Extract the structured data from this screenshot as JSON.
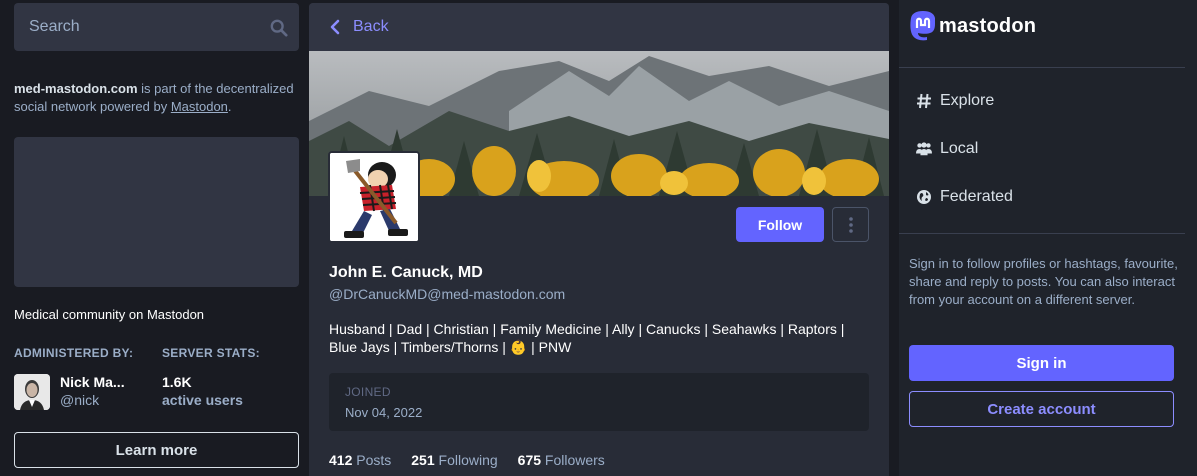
{
  "search": {
    "placeholder": "Search"
  },
  "sidebar_left": {
    "server_domain": "med-mastodon.com",
    "about_text": " is part of the decentralized social network powered by ",
    "mastodon_link": "Mastodon",
    "period": ".",
    "server_description": "Medical community on Mastodon",
    "administered_by_label": "ADMINISTERED BY:",
    "server_stats_label": "SERVER STATS:",
    "admin_name": "Nick Ma...",
    "admin_handle": "@nick",
    "stat_value": "1.6K",
    "stat_sub": "active users",
    "learn_more": "Learn more"
  },
  "profile": {
    "back_label": "Back",
    "follow_label": "Follow",
    "display_name": "John E. Canuck, MD",
    "account": "@DrCanuckMD@med-mastodon.com",
    "bio_text": "Husband | Dad | Christian | Family Medicine | Ally | Canucks | Seahawks | Raptors | Blue Jays | Timbers/Thorns | ",
    "bio_emoji": "👶",
    "bio_end": " | PNW",
    "joined_label": "JOINED",
    "joined_date": "Nov 04, 2022",
    "counts": [
      {
        "num": "412",
        "label": "Posts"
      },
      {
        "num": "251",
        "label": "Following"
      },
      {
        "num": "675",
        "label": "Followers"
      }
    ]
  },
  "sidebar_right": {
    "logo_text": "mastodon",
    "nav": [
      {
        "label": "Explore",
        "icon": "hashtag-icon"
      },
      {
        "label": "Local",
        "icon": "users-icon"
      },
      {
        "label": "Federated",
        "icon": "globe-icon"
      }
    ],
    "signin_text": "Sign in to follow profiles or hashtags, favourite, share and reply to posts. You can also interact from your account on a different server.",
    "signin_label": "Sign in",
    "create_label": "Create account"
  },
  "colors": {
    "accent": "#6364ff",
    "link": "#8c8dff",
    "background": "#191b22",
    "panel": "#282c37",
    "muted_text": "#9baec8"
  }
}
